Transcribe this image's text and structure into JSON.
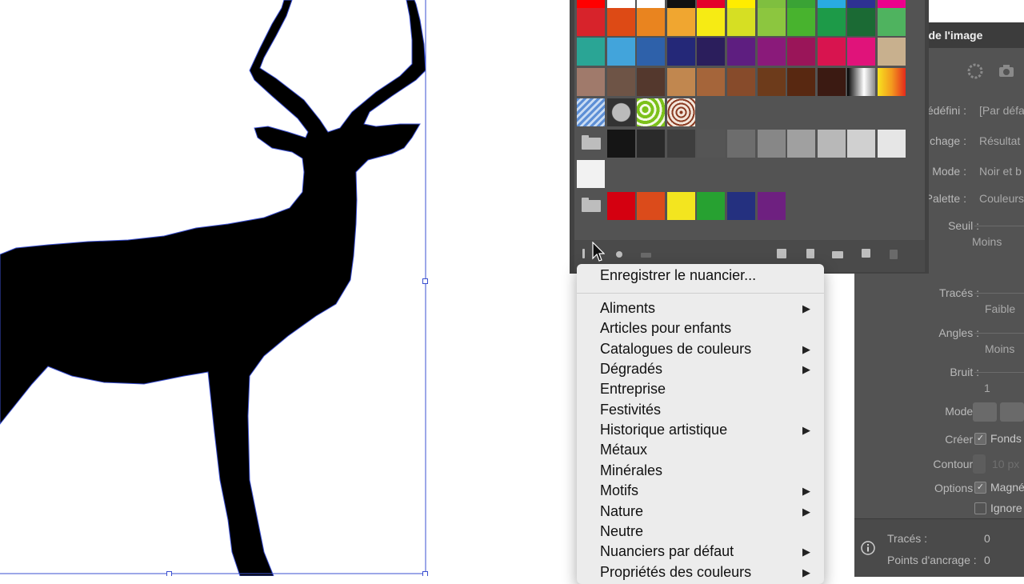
{
  "trace_panel": {
    "tab_title": "n de l'image",
    "rows": [
      {
        "label": "édéfini :",
        "value": "[Par défa"
      },
      {
        "label": "chage :",
        "value": "Résultat"
      },
      {
        "label": "Mode :",
        "value": "Noir et b"
      },
      {
        "label": "Palette :",
        "value": "Couleurs"
      },
      {
        "label": "Seuil :",
        "value": "Moins"
      },
      {
        "label": "Tracés :",
        "value": "Faible"
      },
      {
        "label": "Angles :",
        "value": "Moins"
      },
      {
        "label": "Bruit :",
        "value": "1"
      },
      {
        "label": "Mode :",
        "value": ""
      },
      {
        "label": "Créer :",
        "value": "Fonds"
      },
      {
        "label": "Contour :",
        "value": "10 px"
      },
      {
        "label": "Options :",
        "value": "Magné"
      },
      {
        "label": "",
        "value": "Ignore"
      }
    ],
    "footer": {
      "paths_label": "Tracés :",
      "paths_value": "0",
      "anchors_label": "Points d'ancrage :",
      "anchors_value": "0"
    }
  },
  "swatch_colors": {
    "row0": [
      "#ff0000",
      "#ffffff",
      "#ffffff",
      "#111111",
      "#e4002b",
      "#ffed00",
      "#7fbf3f",
      "#3aa335",
      "#29abe2",
      "#2e3192",
      "#ec008c",
      "#c1272d"
    ],
    "row1": [
      "#d7232b",
      "#dd4a15",
      "#e9841f",
      "#f0a630",
      "#f6eb14",
      "#d6df23",
      "#8cc63f",
      "#48b32e",
      "#1d9a48",
      "#1b6a34",
      "#4fb35f"
    ],
    "row2": [
      "#2aa595",
      "#42a4db",
      "#2e61aa",
      "#242878",
      "#2b1e5c",
      "#5e1e80",
      "#8a1a7a",
      "#9a1559",
      "#d8144f",
      "#e0137a",
      "#c8b08e"
    ],
    "row3": [
      "#a07a6b",
      "#6e5446",
      "#54382d",
      "#c1874f",
      "#a5653a",
      "#874b2b",
      "#6d3b1b",
      "#582811",
      "#3b1a12",
      "gradient-bw",
      "gradient-warm"
    ],
    "row4": [
      "pattern-blue",
      "pattern-dots",
      "pattern-leaves",
      "pattern-swirl"
    ],
    "row5": [
      "#151515",
      "#2a2a2a",
      "#3e3e3e",
      "#555555",
      "#6d6d6d",
      "#878787",
      "#a0a0a0",
      "#b8b8b8",
      "#d0d0d0",
      "#e6e6e6"
    ],
    "row6": [
      "#f2f2f2"
    ],
    "row7": [
      "#d40010",
      "#db4b1b",
      "#f3e51f",
      "#27a131",
      "#24307f",
      "#6e2080"
    ]
  },
  "swatch_toolbar": {
    "icons": [
      "swatch-libraries-menu-icon",
      "open-swatch-kind-icon",
      "cloud-library-icon",
      "show-swatch-kinds-icon",
      "swatch-options-icon",
      "new-color-group-icon",
      "new-swatch-icon",
      "delete-swatch-icon"
    ]
  },
  "menu": {
    "top_item": "Enregistrer le nuancier...",
    "items": [
      {
        "label": "Aliments",
        "submenu": true
      },
      {
        "label": "Articles pour enfants",
        "submenu": false
      },
      {
        "label": "Catalogues de couleurs",
        "submenu": true
      },
      {
        "label": "Dégradés",
        "submenu": true
      },
      {
        "label": "Entreprise",
        "submenu": false
      },
      {
        "label": "Festivités",
        "submenu": false
      },
      {
        "label": "Historique artistique",
        "submenu": true
      },
      {
        "label": "Métaux",
        "submenu": false
      },
      {
        "label": "Minérales",
        "submenu": false
      },
      {
        "label": "Motifs",
        "submenu": true
      },
      {
        "label": "Nature",
        "submenu": true
      },
      {
        "label": "Neutre",
        "submenu": false
      },
      {
        "label": "Nuanciers par défaut",
        "submenu": true
      },
      {
        "label": "Propriétés des couleurs",
        "submenu": true
      }
    ],
    "arrow_glyph": "▶"
  }
}
